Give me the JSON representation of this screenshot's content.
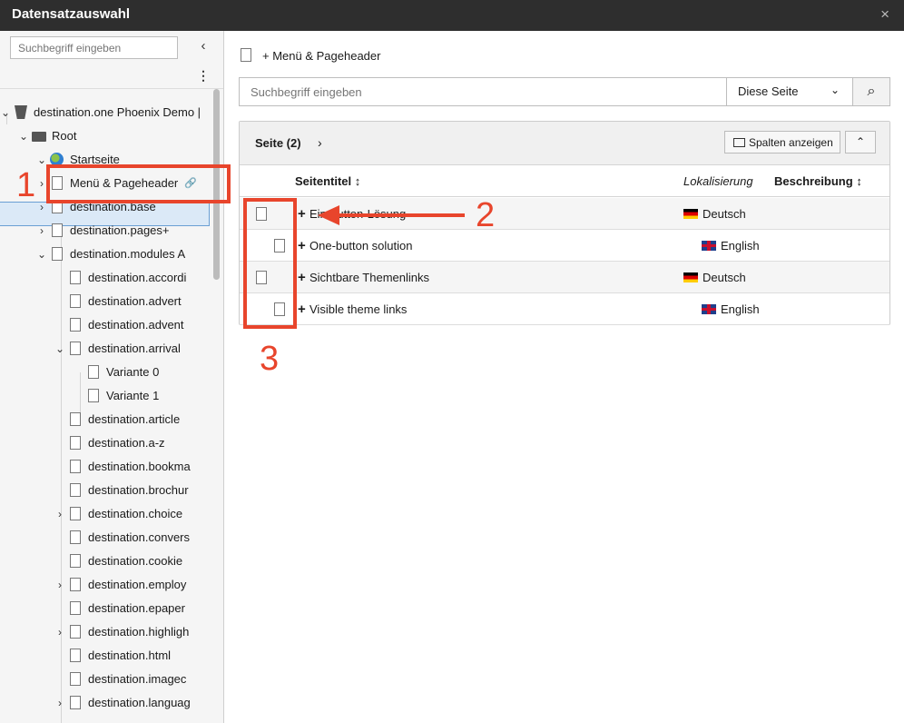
{
  "window": {
    "title": "Datensatzauswahl",
    "close_label": "×"
  },
  "sidebar": {
    "search_placeholder": "Suchbegriff eingeben",
    "collapse_icon": "‹",
    "menu_icon": "⋮",
    "tree": [
      {
        "label": "destination.one Phoenix Demo |",
        "icon": "typo3-icon"
      },
      {
        "label": "Root",
        "icon": "folder-icon"
      },
      {
        "label": "Startseite",
        "icon": "globe-icon"
      },
      {
        "label": "Menü & Pageheader",
        "icon": "page-icon"
      },
      {
        "label": "destination.base",
        "icon": "page-icon"
      },
      {
        "label": "destination.pages+",
        "icon": "page-icon"
      },
      {
        "label": "destination.modules A",
        "icon": "page-icon"
      },
      {
        "label": "destination.accordi",
        "icon": "page-icon"
      },
      {
        "label": "destination.advert",
        "icon": "page-icon"
      },
      {
        "label": "destination.advent",
        "icon": "page-icon"
      },
      {
        "label": "destination.arrival",
        "icon": "page-icon"
      },
      {
        "label": "Variante 0",
        "icon": "page-icon"
      },
      {
        "label": "Variante 1",
        "icon": "page-icon"
      },
      {
        "label": "destination.article",
        "icon": "page-icon"
      },
      {
        "label": "destination.a-z",
        "icon": "page-icon"
      },
      {
        "label": "destination.bookma",
        "icon": "page-icon"
      },
      {
        "label": "destination.brochur",
        "icon": "page-icon"
      },
      {
        "label": "destination.choice",
        "icon": "page-icon"
      },
      {
        "label": "destination.convers",
        "icon": "page-icon"
      },
      {
        "label": "destination.cookie",
        "icon": "page-icon"
      },
      {
        "label": "destination.employ",
        "icon": "page-icon"
      },
      {
        "label": "destination.epaper",
        "icon": "page-icon"
      },
      {
        "label": "destination.highligh",
        "icon": "page-icon"
      },
      {
        "label": "destination.html",
        "icon": "page-icon"
      },
      {
        "label": "destination.imagec",
        "icon": "page-icon"
      },
      {
        "label": "destination.languag",
        "icon": "page-icon"
      }
    ]
  },
  "main": {
    "breadcrumb": "Menü & Pageheader",
    "search": {
      "placeholder": "Suchbegriff eingeben",
      "scope": "Diese Seite"
    },
    "panel": {
      "title": "Seite (2)",
      "columns_button": "Spalten anzeigen",
      "headers": {
        "title": "Seitentitel",
        "localization": "Lokalisierung",
        "description": "Beschreibung"
      },
      "rows": [
        {
          "title": "Ein-button-Lösung",
          "language": "Deutsch",
          "flag": "flag-de-icon"
        },
        {
          "title": "One-button solution",
          "language": "English",
          "flag": "flag-gb-icon"
        },
        {
          "title": "Sichtbare Themenlinks",
          "language": "Deutsch",
          "flag": "flag-de-icon"
        },
        {
          "title": "Visible theme links",
          "language": "English",
          "flag": "flag-gb-icon"
        }
      ]
    }
  },
  "annotations": {
    "n1": "1",
    "n2": "2",
    "n3": "3",
    "color": "#e8452c"
  }
}
